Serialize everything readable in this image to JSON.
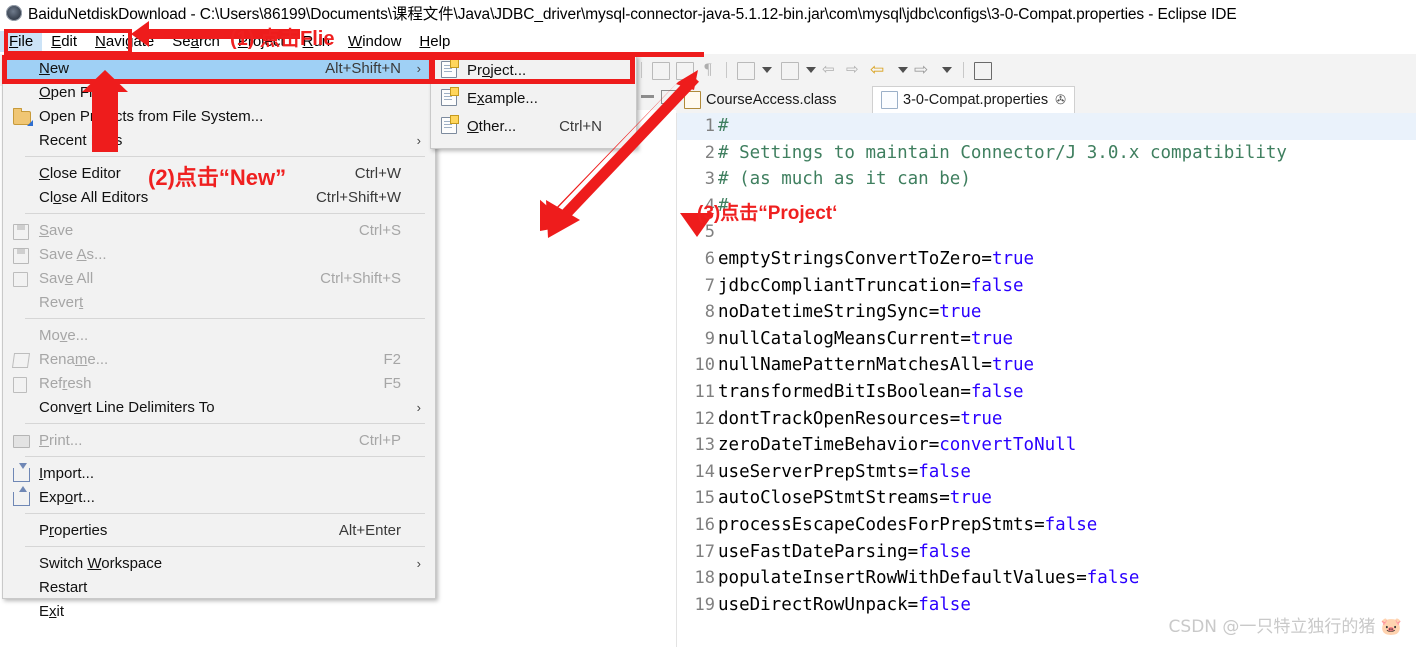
{
  "window": {
    "title": "BaiduNetdiskDownload - C:\\Users\\86199\\Documents\\课程文件\\Java\\JDBC_driver\\mysql-connector-java-5.1.12-bin.jar\\com\\mysql\\jdbc\\configs\\3-0-Compat.properties - Eclipse IDE",
    "app_icon": "eclipse-icon"
  },
  "menubar": {
    "items": [
      {
        "label": "File",
        "mnemonic": "F",
        "active": true
      },
      {
        "label": "Edit",
        "mnemonic": "E",
        "active": false
      },
      {
        "label": "Navigate",
        "mnemonic": "N",
        "active": false
      },
      {
        "label": "Search",
        "mnemonic": "a",
        "active": false
      },
      {
        "label": "Project",
        "mnemonic": "P",
        "active": false
      },
      {
        "label": "Run",
        "mnemonic": "R",
        "active": false
      },
      {
        "label": "Window",
        "mnemonic": "W",
        "active": false
      },
      {
        "label": "Help",
        "mnemonic": "H",
        "active": false
      }
    ]
  },
  "file_menu": {
    "items": [
      {
        "label": "New",
        "accel": "Alt+Shift+N",
        "submenu": true,
        "selected": true,
        "disabled": false,
        "icon": "none"
      },
      {
        "label": "Open File...",
        "accel": "",
        "submenu": false,
        "selected": false,
        "disabled": false,
        "icon": "none"
      },
      {
        "label": "Open Projects from File System...",
        "accel": "",
        "submenu": false,
        "selected": false,
        "disabled": false,
        "icon": "folder-icon"
      },
      {
        "label": "Recent Files",
        "accel": "",
        "submenu": true,
        "selected": false,
        "disabled": false,
        "icon": "none"
      },
      {
        "separator": true
      },
      {
        "label": "Close Editor",
        "accel": "Ctrl+W",
        "submenu": false,
        "selected": false,
        "disabled": false,
        "icon": "none"
      },
      {
        "label": "Close All Editors",
        "accel": "Ctrl+Shift+W",
        "submenu": false,
        "selected": false,
        "disabled": false,
        "icon": "none"
      },
      {
        "separator": true
      },
      {
        "label": "Save",
        "accel": "Ctrl+S",
        "submenu": false,
        "selected": false,
        "disabled": true,
        "icon": "save-icon"
      },
      {
        "label": "Save As...",
        "accel": "",
        "submenu": false,
        "selected": false,
        "disabled": true,
        "icon": "save-as-icon"
      },
      {
        "label": "Save All",
        "accel": "Ctrl+Shift+S",
        "submenu": false,
        "selected": false,
        "disabled": true,
        "icon": "save-all-icon"
      },
      {
        "label": "Revert",
        "accel": "",
        "submenu": false,
        "selected": false,
        "disabled": true,
        "icon": "none"
      },
      {
        "separator": true
      },
      {
        "label": "Move...",
        "accel": "",
        "submenu": false,
        "selected": false,
        "disabled": true,
        "icon": "none"
      },
      {
        "label": "Rename...",
        "accel": "F2",
        "submenu": false,
        "selected": false,
        "disabled": true,
        "icon": "rename-icon"
      },
      {
        "label": "Refresh",
        "accel": "F5",
        "submenu": false,
        "selected": false,
        "disabled": true,
        "icon": "refresh-icon"
      },
      {
        "label": "Convert Line Delimiters To",
        "accel": "",
        "submenu": true,
        "selected": false,
        "disabled": false,
        "icon": "none"
      },
      {
        "separator": true
      },
      {
        "label": "Print...",
        "accel": "Ctrl+P",
        "submenu": false,
        "selected": false,
        "disabled": true,
        "icon": "print-icon"
      },
      {
        "separator": true
      },
      {
        "label": "Import...",
        "accel": "",
        "submenu": false,
        "selected": false,
        "disabled": false,
        "icon": "import-icon"
      },
      {
        "label": "Export...",
        "accel": "",
        "submenu": false,
        "selected": false,
        "disabled": false,
        "icon": "export-icon"
      },
      {
        "separator": true
      },
      {
        "label": "Properties",
        "accel": "Alt+Enter",
        "submenu": false,
        "selected": false,
        "disabled": false,
        "icon": "none"
      },
      {
        "separator": true
      },
      {
        "label": "Switch Workspace",
        "accel": "",
        "submenu": true,
        "selected": false,
        "disabled": false,
        "icon": "none"
      },
      {
        "label": "Restart",
        "accel": "",
        "submenu": false,
        "selected": false,
        "disabled": false,
        "icon": "none"
      },
      {
        "label": "Exit",
        "accel": "",
        "submenu": false,
        "selected": false,
        "disabled": false,
        "icon": "none"
      }
    ]
  },
  "new_submenu": {
    "items": [
      {
        "label": "Project...",
        "accel": "",
        "selected": false,
        "icon": "new-project-icon"
      },
      {
        "label": "Example...",
        "accel": "",
        "selected": false,
        "icon": "new-example-icon"
      },
      {
        "label": "Other...",
        "accel": "Ctrl+N",
        "selected": false,
        "icon": "new-other-icon"
      }
    ]
  },
  "editor": {
    "tabs": [
      {
        "label": "CourseAccess.class",
        "icon": "class-file-icon",
        "active": false,
        "closeable": false
      },
      {
        "label": "3-0-Compat.properties",
        "icon": "properties-file-icon",
        "active": true,
        "closeable": true,
        "close_glyph": "✇"
      }
    ],
    "lines": [
      {
        "num": "1",
        "segments": [
          {
            "text": "#",
            "kind": "comment"
          }
        ]
      },
      {
        "num": "2",
        "segments": [
          {
            "text": "# Settings to maintain Connector/J 3.0.x compatibility",
            "kind": "comment"
          }
        ]
      },
      {
        "num": "3",
        "segments": [
          {
            "text": "# (as much as it can be)",
            "kind": "comment"
          }
        ]
      },
      {
        "num": "4",
        "segments": [
          {
            "text": "#",
            "kind": "comment"
          }
        ]
      },
      {
        "num": "5",
        "segments": [
          {
            "text": "",
            "kind": "key"
          }
        ]
      },
      {
        "num": "6",
        "segments": [
          {
            "text": "emptyStringsConvertToZero=",
            "kind": "key"
          },
          {
            "text": "true",
            "kind": "val"
          }
        ]
      },
      {
        "num": "7",
        "segments": [
          {
            "text": "jdbcCompliantTruncation=",
            "kind": "key"
          },
          {
            "text": "false",
            "kind": "val"
          }
        ]
      },
      {
        "num": "8",
        "segments": [
          {
            "text": "noDatetimeStringSync=",
            "kind": "key"
          },
          {
            "text": "true",
            "kind": "val"
          }
        ]
      },
      {
        "num": "9",
        "segments": [
          {
            "text": "nullCatalogMeansCurrent=",
            "kind": "key"
          },
          {
            "text": "true",
            "kind": "val"
          }
        ]
      },
      {
        "num": "10",
        "segments": [
          {
            "text": "nullNamePatternMatchesAll=",
            "kind": "key"
          },
          {
            "text": "true",
            "kind": "val"
          }
        ]
      },
      {
        "num": "11",
        "segments": [
          {
            "text": "transformedBitIsBoolean=",
            "kind": "key"
          },
          {
            "text": "false",
            "kind": "val"
          }
        ]
      },
      {
        "num": "12",
        "segments": [
          {
            "text": "dontTrackOpenResources=",
            "kind": "key"
          },
          {
            "text": "true",
            "kind": "val"
          }
        ]
      },
      {
        "num": "13",
        "segments": [
          {
            "text": "zeroDateTimeBehavior=",
            "kind": "key"
          },
          {
            "text": "convertToNull",
            "kind": "val"
          }
        ]
      },
      {
        "num": "14",
        "segments": [
          {
            "text": "useServerPrepStmts=",
            "kind": "key"
          },
          {
            "text": "false",
            "kind": "val"
          }
        ]
      },
      {
        "num": "15",
        "segments": [
          {
            "text": "autoClosePStmtStreams=",
            "kind": "key"
          },
          {
            "text": "true",
            "kind": "val"
          }
        ]
      },
      {
        "num": "16",
        "segments": [
          {
            "text": "processEscapeCodesForPrepStmts=",
            "kind": "key"
          },
          {
            "text": "false",
            "kind": "val"
          }
        ]
      },
      {
        "num": "17",
        "segments": [
          {
            "text": "useFastDateParsing=",
            "kind": "key"
          },
          {
            "text": "false",
            "kind": "val"
          }
        ]
      },
      {
        "num": "18",
        "segments": [
          {
            "text": "populateInsertRowWithDefaultValues=",
            "kind": "key"
          },
          {
            "text": "false",
            "kind": "val"
          }
        ]
      },
      {
        "num": "19",
        "segments": [
          {
            "text": "useDirectRowUnpack=",
            "kind": "key"
          },
          {
            "text": "false",
            "kind": "val"
          }
        ]
      }
    ]
  },
  "toolbar": {
    "icons": [
      "new-wizard-icon",
      "open-type-icon",
      "paragraph-mark-icon",
      "debug-icon",
      "debug-dropdown-icon",
      "run-icon",
      "run-dropdown-icon",
      "prev-annotation-icon",
      "next-annotation-icon",
      "back-icon",
      "back-dropdown-icon",
      "forward-icon",
      "forward-dropdown-icon",
      "new-window-icon"
    ],
    "panel_minimize": "minimize-icon",
    "panel_maximize": "maximize-icon"
  },
  "annotations": {
    "step1": "(1) 点击Flie",
    "step2": "(2)点击“New”",
    "step3": "(3)点击“Project‘",
    "highlight_color": "#ee1c1c"
  },
  "watermark": {
    "text": "CSDN @一只特立独行的猪 🐷"
  }
}
